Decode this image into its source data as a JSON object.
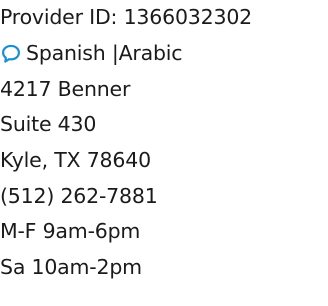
{
  "provider": {
    "provider_id_label": "Provider ID:",
    "provider_id_value": "1366032302",
    "languages_icon": "speech-bubble-icon",
    "languages": "Spanish |Arabic",
    "address_line1": "4217 Benner",
    "address_line2": "Suite 430",
    "city_state_zip": "Kyle, TX 78640",
    "phone": "(512) 262-7881",
    "hours_weekday": "M-F 9am-6pm",
    "hours_saturday": "Sa 10am-2pm"
  },
  "colors": {
    "text": "#1b1b1b",
    "accent": "#1a8fd6",
    "background": "#ffffff"
  }
}
